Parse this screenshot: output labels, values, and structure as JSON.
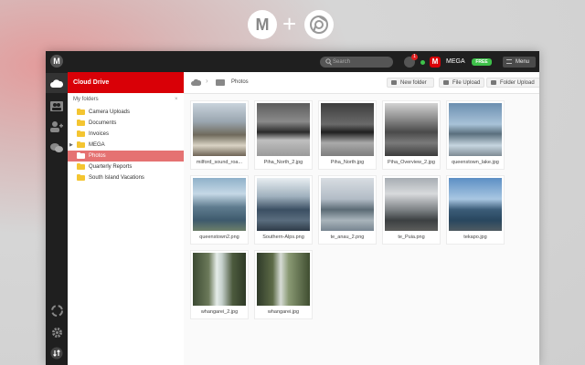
{
  "app": {
    "hero": {
      "plus": "+"
    },
    "header": {
      "search_placeholder": "Search",
      "notification_count": "1",
      "user_logo": "M",
      "user_name": "MEGA",
      "plan_badge": "FREE",
      "menu_label": "Menu"
    },
    "rail": {
      "logo": "M"
    },
    "sidebar": {
      "header": "Cloud Drive",
      "folders_label": "My folders",
      "folders_close": "×",
      "items": [
        {
          "label": "Camera Uploads",
          "active": false,
          "expandable": false
        },
        {
          "label": "Documents",
          "active": false,
          "expandable": false
        },
        {
          "label": "Invoices",
          "active": false,
          "expandable": false
        },
        {
          "label": "MEGA",
          "active": false,
          "expandable": true
        },
        {
          "label": "Photos",
          "active": true,
          "expandable": false
        },
        {
          "label": "Quarterly Reports",
          "active": false,
          "expandable": false
        },
        {
          "label": "South Island Vacations",
          "active": false,
          "expandable": false
        }
      ]
    },
    "toolbar": {
      "breadcrumb_sep": "›",
      "current_folder": "Photos",
      "new_folder": "New folder",
      "file_upload": "File Upload",
      "folder_upload": "Folder Upload"
    },
    "files": [
      "milford_sound_roa...",
      "Piha_North_2.jpg",
      "Piha_North.jpg",
      "Piha_Overview_2.jpg",
      "queenstown_lake.jpg",
      "queenstown2.png",
      "Southern-Alps.png",
      "te_anau_2.png",
      "te_Puia.png",
      "tekapo.jpg",
      "whangarei_2.jpg",
      "whangarei.jpg"
    ]
  },
  "colors": {
    "accent": "#d90007",
    "folder": "#f4c531",
    "online": "#3ec14a",
    "dark_chrome": "#1f1f1f"
  },
  "icons": {
    "rail": [
      "cloud-icon",
      "contacts-icon",
      "shared-icon",
      "chat-icon",
      "rubbish-bin-icon",
      "settings-icon",
      "transfers-icon"
    ]
  }
}
